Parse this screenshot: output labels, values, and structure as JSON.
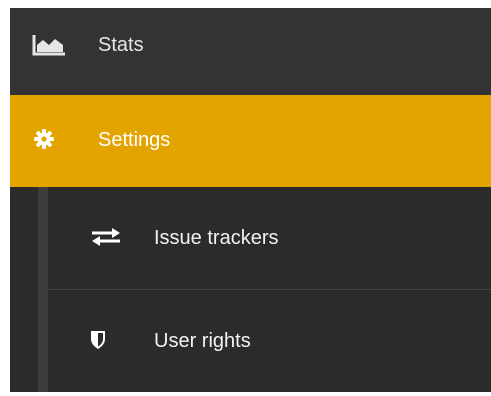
{
  "sidebar": {
    "stats": {
      "label": "Stats",
      "icon": "area-chart-icon"
    },
    "settings": {
      "label": "Settings",
      "icon": "gear-icon",
      "active": true
    },
    "settings_submenu": [
      {
        "label": "Issue trackers",
        "icon": "exchange-arrows-icon"
      },
      {
        "label": "User rights",
        "icon": "shield-icon"
      }
    ]
  },
  "colors": {
    "sidebar_bg": "#333333",
    "submenu_bg": "#2b2b2b",
    "active_bg": "#e3a400",
    "text": "#ffffff"
  }
}
